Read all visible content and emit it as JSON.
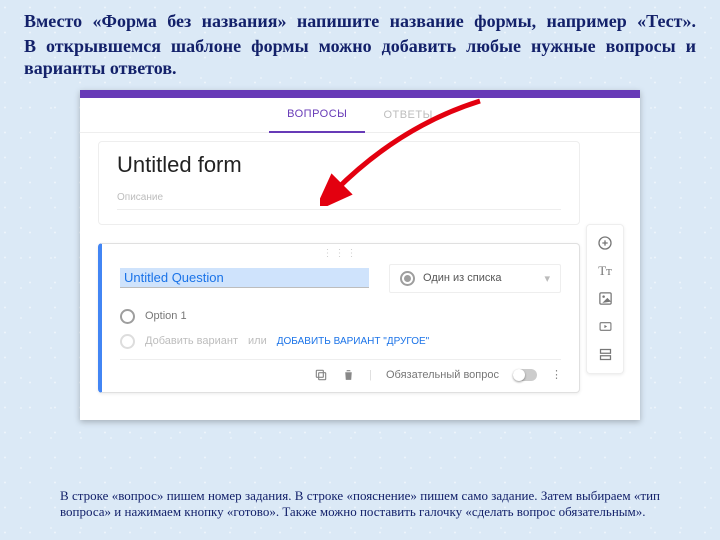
{
  "instructions": {
    "line1": "Вместо «Форма без названия» напишите название формы, например «Тест».",
    "line2": "В открывшемся шаблоне формы можно добавить любые нужные вопросы и варианты ответов."
  },
  "tabs": {
    "questions": "ВОПРОСЫ",
    "answers": "ОТВЕТЫ"
  },
  "form": {
    "title": "Untitled form",
    "description_placeholder": "Описание"
  },
  "question": {
    "title": "Untitled Question",
    "type_label": "Один из списка",
    "option1": "Option 1",
    "add_option": "Добавить вариант",
    "or": " или ",
    "add_other": "ДОБАВИТЬ ВАРИАНТ \"ДРУГОЕ\"",
    "required_label": "Обязательный вопрос"
  },
  "footer_note": "В строке «вопрос» пишем номер задания. В строке «пояснение» пишем само задание. Затем выбираем «тип вопроса» и нажимаем кнопку «готово». Также можно поставить галочку «сделать вопрос обязательным»."
}
